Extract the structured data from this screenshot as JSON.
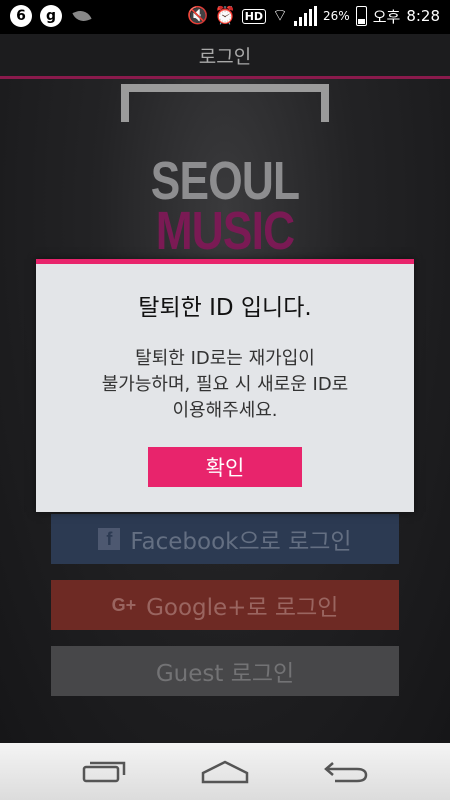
{
  "statusbar": {
    "left_icons": [
      "6",
      "g"
    ],
    "battery_percent": "26%",
    "ampm": "오후",
    "time": "8:28",
    "hd_label": "HD"
  },
  "titlebar": {
    "title": "로그인"
  },
  "logo": {
    "line1": "SEOUL",
    "line2": "MUSIC"
  },
  "login": {
    "facebook_label": "Facebook으로 로그인",
    "google_label": "Google+로 로그인",
    "google_icon": "G+",
    "facebook_icon": "f",
    "guest_label": "Guest 로그인"
  },
  "dialog": {
    "title": "탈퇴한 ID 입니다.",
    "message_lines": [
      "탈퇴한 ID로는 재가입이",
      "불가능하며, 필요 시 새로운 ID로",
      "이용해주세요."
    ],
    "confirm_label": "확인",
    "accent_color": "#e8246c"
  },
  "navbar": {
    "icons": [
      "recent-apps-icon",
      "home-icon",
      "back-icon"
    ]
  }
}
